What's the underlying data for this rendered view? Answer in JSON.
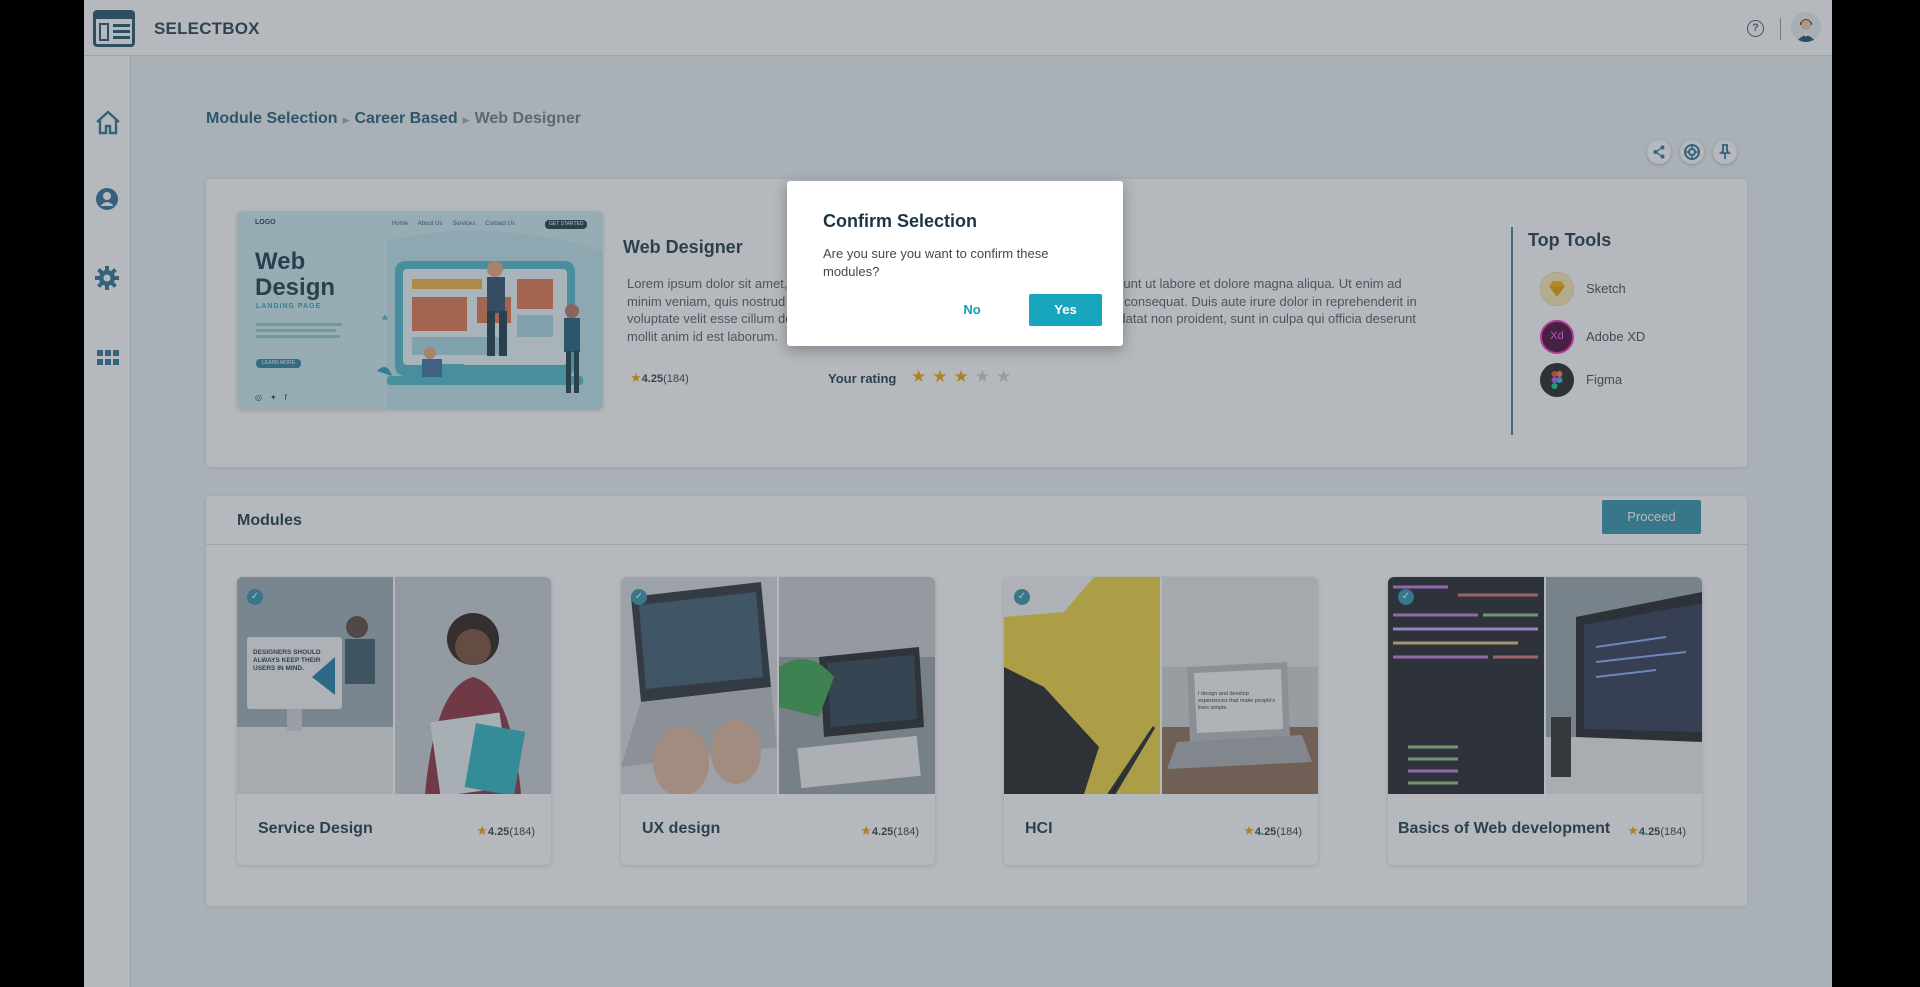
{
  "app": {
    "brand": "SELECTBOX"
  },
  "header": {
    "help_icon": "help-circle-icon",
    "avatar_icon": "user-avatar"
  },
  "sidebar": {
    "items": [
      {
        "name": "home",
        "icon": "home-icon"
      },
      {
        "name": "profile",
        "icon": "user-icon"
      },
      {
        "name": "settings",
        "icon": "gear-icon"
      },
      {
        "name": "apps",
        "icon": "grid-icon"
      }
    ]
  },
  "breadcrumb": {
    "items": [
      "Module Selection",
      "Career Based"
    ],
    "current": "Web Designer"
  },
  "toolbar": {
    "icons": [
      "share-icon",
      "globe-icon",
      "pin-icon"
    ]
  },
  "hero": {
    "title": "Web Designer",
    "description": "Lorem ipsum dolor sit amet, consectetur adipiscing elit, sed do eiusmod tempor incididunt ut labore et dolore magna aliqua. Ut enim ad minim veniam, quis nostrud exercitation ullamco laboris nisi ut aliquip ex ea commodo consequat. Duis aute irure dolor in reprehenderit in voluptate velit esse cillum dolore eu fugiat nulla pariatur. Excepteur sint occaecat cupidatat non proident, sunt in culpa qui officia deserunt mollit anim id est laborum.",
    "rating": "4.25",
    "rating_count": "(184)",
    "your_rating_label": "Your rating",
    "your_rating_value": 3,
    "your_rating_max": 5,
    "image": {
      "logo": "LOGO",
      "nav": [
        "Home",
        "About Us",
        "Services",
        "Contact Us"
      ],
      "cta": "GET STARTED",
      "heading_line1": "Web",
      "heading_line2": "Design",
      "subheading": "LANDING PAGE",
      "button": "LEARN MORE"
    }
  },
  "top_tools": {
    "title": "Top Tools",
    "items": [
      {
        "name": "Sketch",
        "icon": "sketch-icon",
        "color": "#f7b500"
      },
      {
        "name": "Adobe XD",
        "icon": "adobe-xd-icon",
        "color": "#ff26be",
        "badge": "Xd"
      },
      {
        "name": "Figma",
        "icon": "figma-icon",
        "color": "#1e1e1e"
      }
    ]
  },
  "modules": {
    "title": "Modules",
    "proceed_label": "Proceed",
    "cards": [
      {
        "title": "Service Design",
        "rating": "4.25",
        "count": "(184)",
        "selected": true,
        "image_text": "DESIGNERS SHOULD ALWAYS KEEP THEIR USERS IN MIND."
      },
      {
        "title": "UX design",
        "rating": "4.25",
        "count": "(184)",
        "selected": true
      },
      {
        "title": "HCI",
        "rating": "4.25",
        "count": "(184)",
        "selected": true,
        "image_text": "I design and develop experiences that make people's lives simple."
      },
      {
        "title": "Basics of Web development",
        "rating": "4.25",
        "count": "(184)",
        "selected": true
      }
    ]
  },
  "dialog": {
    "title": "Confirm Selection",
    "message": "Are you sure you want to confirm these modules?",
    "no_label": "No",
    "yes_label": "Yes"
  },
  "colors": {
    "accent": "#17a6bd",
    "primary_dark": "#1c3545",
    "link": "#1c5a78",
    "star": "#f0a500",
    "proceed": "#2f8fa8"
  }
}
